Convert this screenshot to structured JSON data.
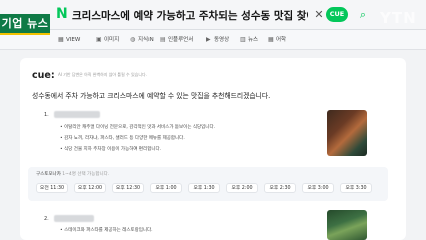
{
  "header": {
    "logo": "N",
    "query": "크리스마스에 예약 가능하고 주차되는 성수동 맛집 찾아줘",
    "cue_button": "CUE"
  },
  "watermark": "YTN",
  "news_badge": "기업 뉴스",
  "tabs": [
    {
      "icon": "▦",
      "label": "VIEW"
    },
    {
      "icon": "▣",
      "label": "이미지"
    },
    {
      "icon": "◍",
      "label": "지식iN"
    },
    {
      "icon": "▤",
      "label": "인플루언서"
    },
    {
      "icon": "▶",
      "label": "동영상"
    },
    {
      "icon": "▥",
      "label": "뉴스"
    },
    {
      "icon": "▦",
      "label": "어학"
    }
  ],
  "cue": {
    "logo": "cue:",
    "disclaimer": "AI 기반 답변은 아직 완벽하지 않아 틀릴 수 있습니다.",
    "summary": "성수동에서 주차 가능하고 크리스마스에 예약할 수 있는 맛집을 추천해드리겠습니다.",
    "items": [
      {
        "num": "1.",
        "bullets": [
          "이탈리안 캐주얼 다이닝 전문으로, 감각적인 맛과 서비스가 돋보이는 식당입니다.",
          "감자 뇨끼, 라자냐, 파스타, 샐러드 등 다양한 메뉴를 제공합니다.",
          "식당 건물 지하 주차장 이용이 가능하여 편리합니다."
        ]
      },
      {
        "num": "2.",
        "bullets": [
          "스테이크와 파스타를 제공하는 레스토랑입니다."
        ]
      }
    ],
    "booking": {
      "label": "구스토모나카",
      "hint": "1~4명 선택 가능합니다.",
      "slots": [
        "오전 11:30",
        "오후 12:00",
        "오후 12:30",
        "오후 1:00",
        "오후 1:30",
        "오후 2:00",
        "오후 2:30",
        "오후 3:00",
        "오후 3:30"
      ]
    }
  }
}
